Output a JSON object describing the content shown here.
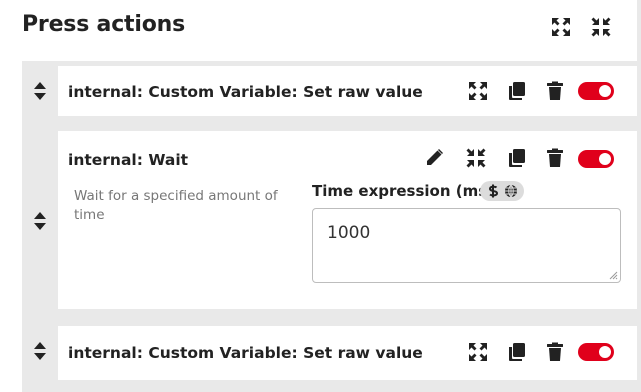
{
  "panel": {
    "title": "Press actions",
    "expand_all_label": "expand-all-icon",
    "collapse_all_label": "collapse-all-icon"
  },
  "actions": [
    {
      "name": "internal: Custom Variable: Set raw value",
      "expanded": false,
      "enabled": true
    },
    {
      "name": "internal: Wait",
      "expanded": true,
      "enabled": true,
      "description": "Wait for a specified amount of time",
      "option": {
        "label": "Time expression (ms)",
        "value": "1000"
      }
    },
    {
      "name": "internal: Custom Variable: Set raw value",
      "expanded": false,
      "enabled": true
    }
  ],
  "colors": {
    "toggle_on": "#e0001b",
    "row_bg": "#e9e9e9",
    "card_bg": "#ffffff"
  },
  "icons": [
    "expand-icon",
    "compress-icon",
    "copy-icon",
    "trash-icon",
    "pencil-icon",
    "sort-icon",
    "dollar-icon",
    "globe-icon"
  ]
}
